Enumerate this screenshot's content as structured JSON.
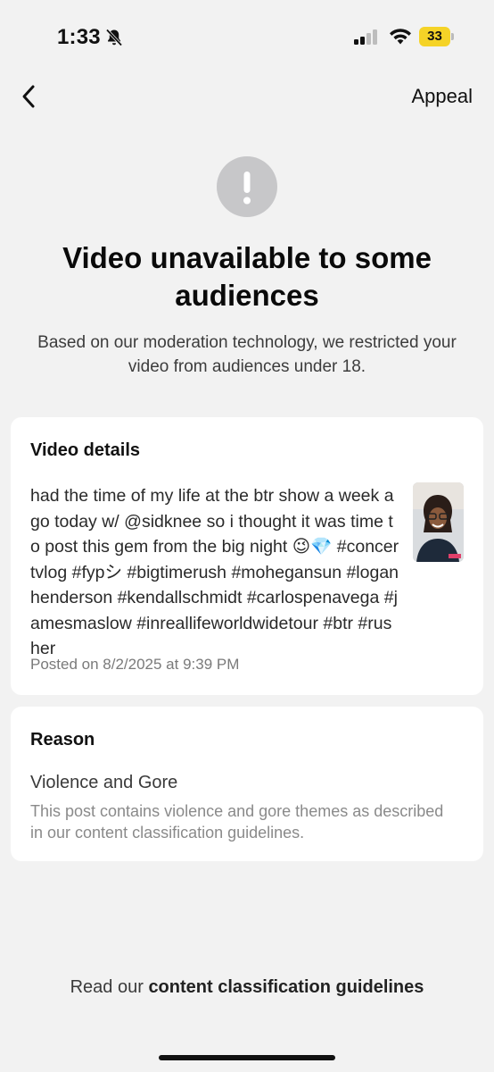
{
  "status_bar": {
    "time": "1:33",
    "battery": "33",
    "icons": [
      "bell-slash-icon",
      "signal-icon",
      "wifi-icon",
      "battery-icon"
    ]
  },
  "nav": {
    "back_icon": "chevron-left-icon",
    "appeal_label": "Appeal"
  },
  "header": {
    "icon": "exclamation-icon",
    "title": "Video unavailable to some audiences",
    "subtitle": "Based on our moderation technology, we restricted your video from audiences under 18."
  },
  "video_details": {
    "heading": "Video details",
    "caption": "had the time of my life at the btr show a week ago today w/ @sidknee so i thought it was time to post this gem from the big night 😉💎 #concertvlog #fypシ #bigtimerush #mohegansun #loganhenderson #kendallschmidt #carlospenavega #jamesmaslow #inreallifeworldwidetour #btr #rusher",
    "posted": "Posted on 8/2/2025 at 9:39 PM"
  },
  "reason": {
    "heading": "Reason",
    "title": "Violence and Gore",
    "description": "This post contains violence and gore themes as described in our content classification guidelines."
  },
  "footer": {
    "prefix": "Read our ",
    "link_label": "content classification guidelines"
  },
  "colors": {
    "background": "#f2f2f2",
    "card": "#ffffff",
    "battery": "#f5d327",
    "alert_circle": "#c7c7c9"
  }
}
